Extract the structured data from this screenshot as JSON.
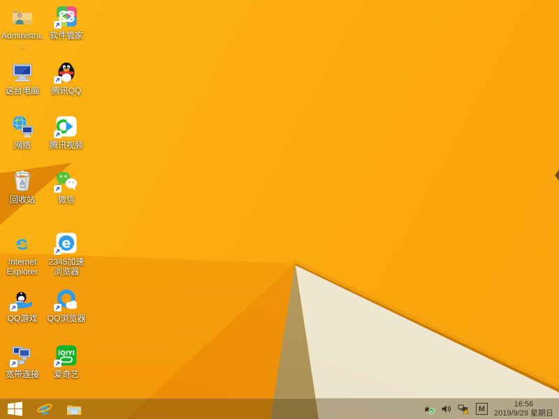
{
  "wallpaper": {
    "base_orange": "#FAA90E",
    "bright_orange": "#FCB414",
    "deep_fold_orange": "#EC8C05",
    "dark_fold": "#D07A04",
    "tan_facet": "#B2985C",
    "cream_facet": "#F4EDDA",
    "edge_line": "#C67A02"
  },
  "desktop": {
    "icons": [
      {
        "id": "user-folder",
        "label": "Administra...",
        "shortcut": false
      },
      {
        "id": "software-manager",
        "label": "软件管家",
        "shortcut": true
      },
      {
        "id": "this-pc",
        "label": "这台电脑",
        "shortcut": false
      },
      {
        "id": "tencent-qq",
        "label": "腾讯QQ",
        "shortcut": true
      },
      {
        "id": "network",
        "label": "网络",
        "shortcut": false
      },
      {
        "id": "tencent-video",
        "label": "腾讯视频",
        "shortcut": true
      },
      {
        "id": "recycle-bin",
        "label": "回收站",
        "shortcut": false
      },
      {
        "id": "wechat",
        "label": "微信",
        "shortcut": true
      },
      {
        "id": "internet-explorer",
        "label": "Internet Explorer",
        "shortcut": false
      },
      {
        "id": "browser-2345",
        "label": "2345加速浏览器",
        "shortcut": true
      },
      {
        "id": "qq-games",
        "label": "QQ游戏",
        "shortcut": true
      },
      {
        "id": "qq-browser",
        "label": "QQ浏览器",
        "shortcut": true
      },
      {
        "id": "broadband",
        "label": "宽带连接",
        "shortcut": true
      },
      {
        "id": "iqiyi",
        "label": "爱奇艺",
        "shortcut": true
      }
    ]
  },
  "taskbar": {
    "pinned_icons": [
      "windows-start",
      "internet-explorer",
      "file-explorer"
    ],
    "tray_icons": [
      "usb-safely-remove",
      "volume",
      "network-warning",
      "ime-indicator"
    ],
    "tray": {
      "ime_label": "M",
      "time": "16:56",
      "date": "2019/9/29 星期日"
    }
  }
}
